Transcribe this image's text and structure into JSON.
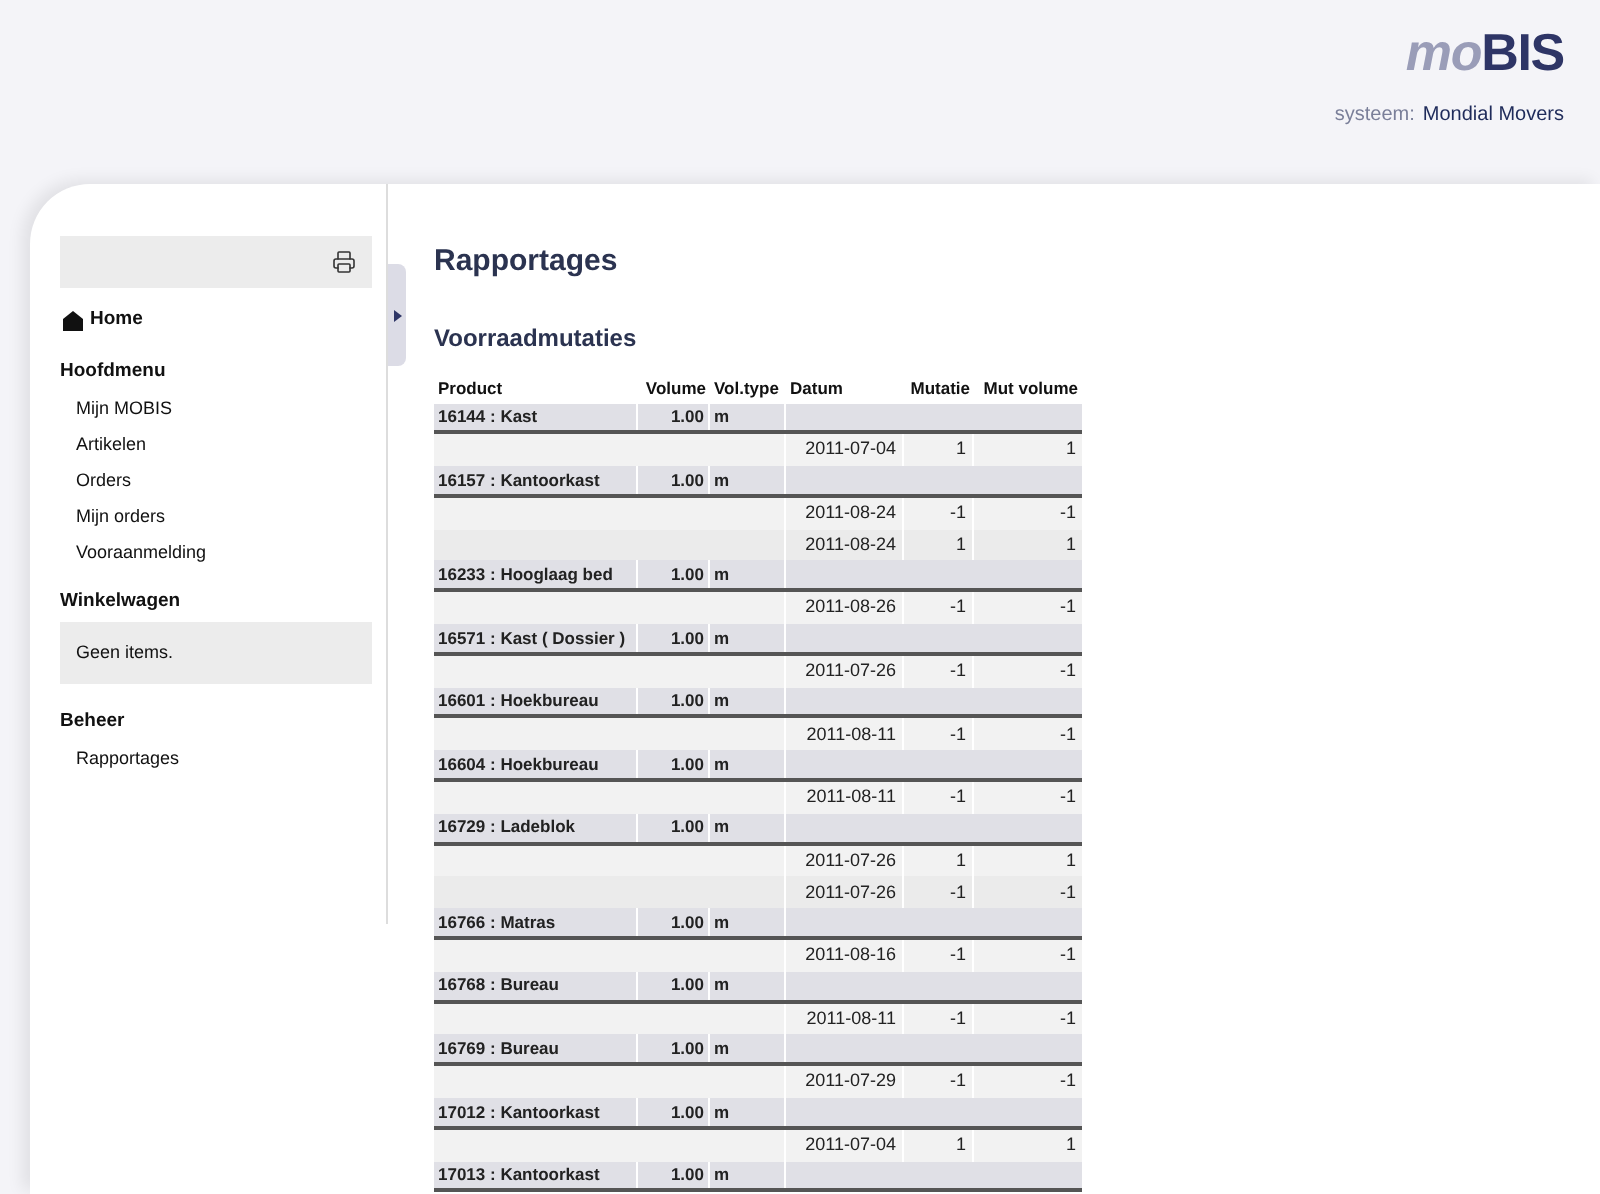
{
  "header": {
    "logo": {
      "prefix": "mo",
      "suffix": "BIS"
    },
    "system_label": "systeem:",
    "system_name": "Mondial Movers"
  },
  "sidebar": {
    "home": "Home",
    "sections": [
      {
        "title": "Hoofdmenu",
        "items": [
          "Mijn MOBIS",
          "Artikelen",
          "Orders",
          "Mijn orders",
          "Vooraanmelding"
        ]
      },
      {
        "title": "Winkelwagen",
        "note": "Geen items."
      },
      {
        "title": "Beheer",
        "items": [
          "Rapportages"
        ]
      }
    ]
  },
  "page_title": "Rapportages",
  "report": {
    "title": "Voorraadmutaties",
    "columns": [
      "Product",
      "Volume",
      "Vol.type",
      "Datum",
      "Mutatie",
      "Mut volume"
    ],
    "groups": [
      {
        "product": "16144 : Kast",
        "volume": "1.00",
        "vol_type": "m",
        "entries": [
          {
            "datum": "2011-07-04",
            "mutatie": "1",
            "mut_volume": "1"
          }
        ]
      },
      {
        "product": "16157 : Kantoorkast",
        "volume": "1.00",
        "vol_type": "m",
        "entries": [
          {
            "datum": "2011-08-24",
            "mutatie": "-1",
            "mut_volume": "-1"
          },
          {
            "datum": "2011-08-24",
            "mutatie": "1",
            "mut_volume": "1"
          }
        ]
      },
      {
        "product": "16233 : Hooglaag bed",
        "volume": "1.00",
        "vol_type": "m",
        "entries": [
          {
            "datum": "2011-08-26",
            "mutatie": "-1",
            "mut_volume": "-1"
          }
        ]
      },
      {
        "product": "16571 : Kast ( Dossier )",
        "volume": "1.00",
        "vol_type": "m",
        "entries": [
          {
            "datum": "2011-07-26",
            "mutatie": "-1",
            "mut_volume": "-1"
          }
        ]
      },
      {
        "product": "16601 : Hoekbureau",
        "volume": "1.00",
        "vol_type": "m",
        "entries": [
          {
            "datum": "2011-08-11",
            "mutatie": "-1",
            "mut_volume": "-1"
          }
        ]
      },
      {
        "product": "16604 : Hoekbureau",
        "volume": "1.00",
        "vol_type": "m",
        "entries": [
          {
            "datum": "2011-08-11",
            "mutatie": "-1",
            "mut_volume": "-1"
          }
        ]
      },
      {
        "product": "16729 : Ladeblok",
        "volume": "1.00",
        "vol_type": "m",
        "entries": [
          {
            "datum": "2011-07-26",
            "mutatie": "1",
            "mut_volume": "1"
          },
          {
            "datum": "2011-07-26",
            "mutatie": "-1",
            "mut_volume": "-1"
          }
        ]
      },
      {
        "product": "16766 : Matras",
        "volume": "1.00",
        "vol_type": "m",
        "entries": [
          {
            "datum": "2011-08-16",
            "mutatie": "-1",
            "mut_volume": "-1"
          }
        ]
      },
      {
        "product": "16768 : Bureau",
        "volume": "1.00",
        "vol_type": "m",
        "entries": [
          {
            "datum": "2011-08-11",
            "mutatie": "-1",
            "mut_volume": "-1"
          }
        ]
      },
      {
        "product": "16769 : Bureau",
        "volume": "1.00",
        "vol_type": "m",
        "entries": [
          {
            "datum": "2011-07-29",
            "mutatie": "-1",
            "mut_volume": "-1"
          }
        ]
      },
      {
        "product": "17012 : Kantoorkast",
        "volume": "1.00",
        "vol_type": "m",
        "entries": [
          {
            "datum": "2011-07-04",
            "mutatie": "1",
            "mut_volume": "1"
          }
        ]
      },
      {
        "product": "17013 : Kantoorkast",
        "volume": "1.00",
        "vol_type": "m"
      }
    ]
  }
}
